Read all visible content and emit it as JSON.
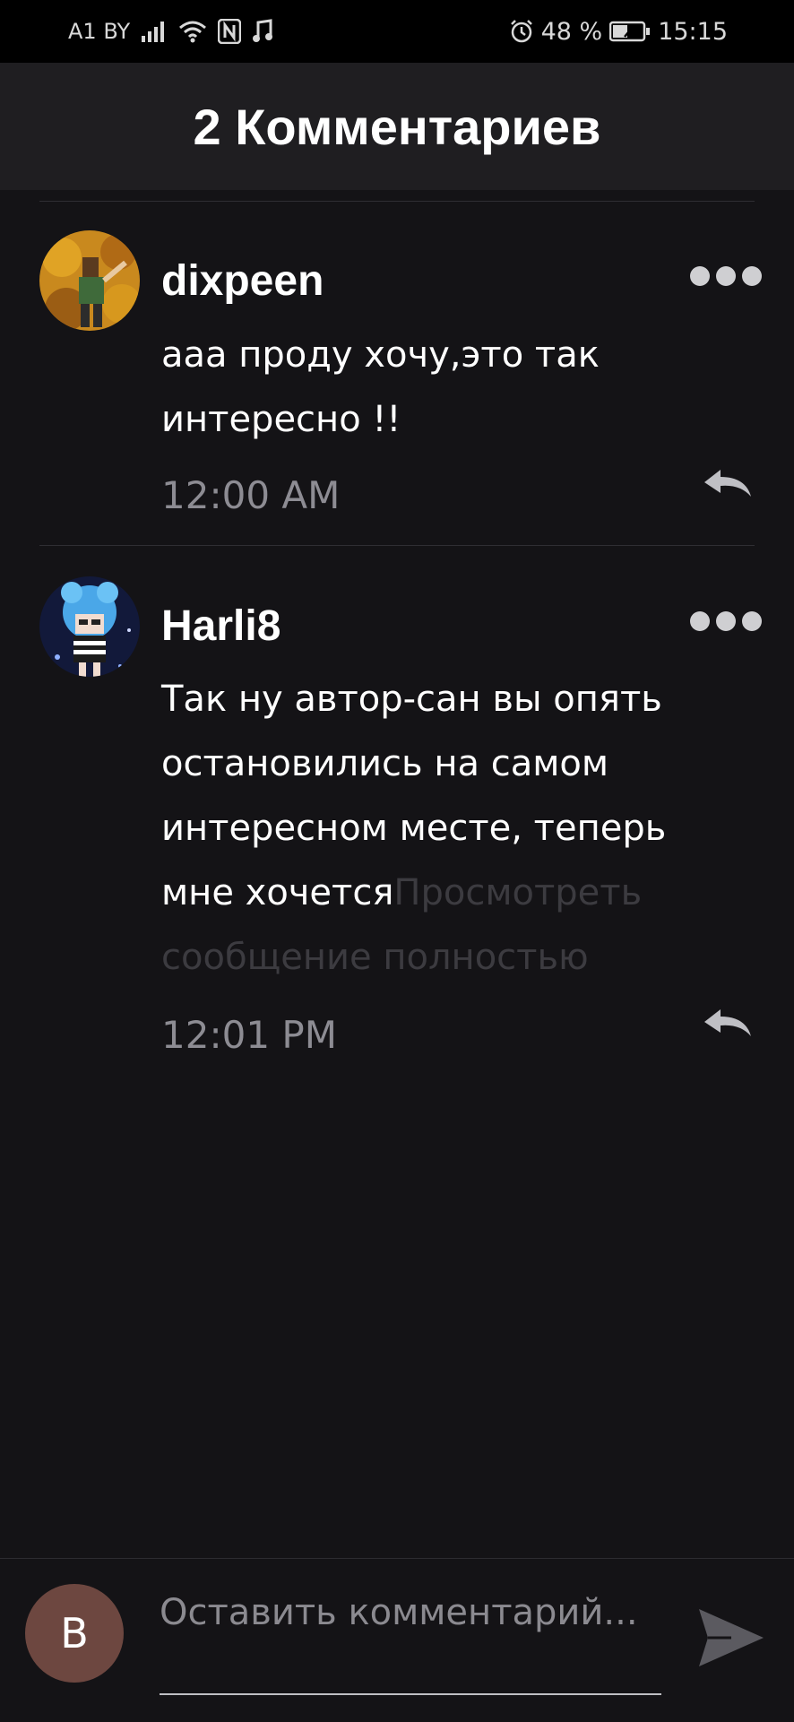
{
  "status_bar": {
    "carrier": "A1 BY",
    "battery": "48 %",
    "time": "15:15",
    "icons": [
      "signal-icon",
      "wifi-icon",
      "nfc-icon",
      "music-note-icon",
      "alarm-icon",
      "battery-icon"
    ]
  },
  "header": {
    "title": "2 Комментариев"
  },
  "comments": [
    {
      "username": "dixpeen",
      "text": "ааа проду хочу,это так интересно !!",
      "more_link": "",
      "time": "12:00 AM",
      "avatar": "avatar-autumn-character"
    },
    {
      "username": "Harli8",
      "text": "Так ну автор-сан вы опять остановились на самом интересном месте, теперь мне хочется",
      "more_link": "Просмотреть сообщение полностью",
      "time": "12:01 PM",
      "avatar": "avatar-blue-hair-character"
    }
  ],
  "composer": {
    "user_initial": "B",
    "placeholder": "Оставить комментарий..."
  },
  "colors": {
    "background": "#141316",
    "header_bg": "#1f1e21",
    "muted_text": "#8d8c93",
    "faded_link": "#3c3b40",
    "user_avatar_bg": "#6d4740"
  }
}
